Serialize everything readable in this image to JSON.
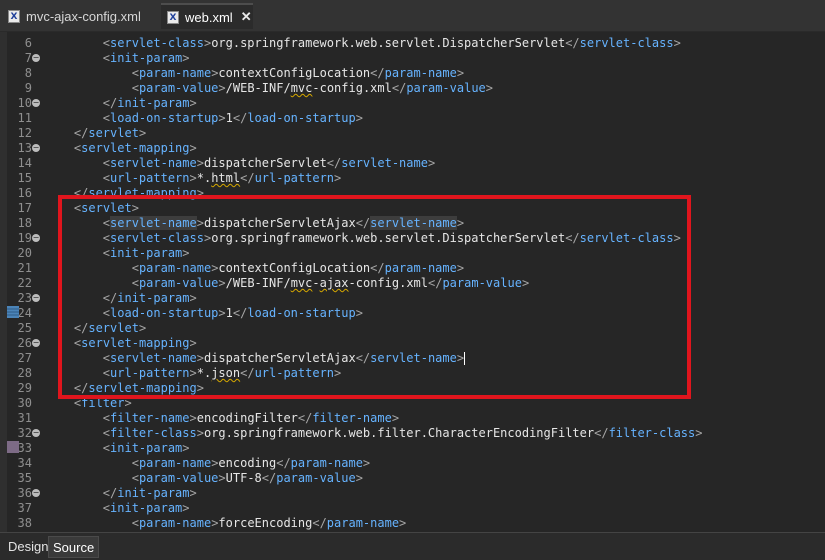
{
  "tabs": [
    {
      "label": "mvc-ajax-config.xml",
      "active": false,
      "icon": "xml-file-icon"
    },
    {
      "label": "web.xml",
      "active": true,
      "icon": "xml-file-icon"
    }
  ],
  "close_glyph": "✕",
  "bottom_tabs": {
    "design": "Design",
    "source": "Source"
  },
  "colors": {
    "tag": "#66b3ff",
    "text": "#e6e6e6",
    "highlight_box": "#e0151d"
  },
  "lines": [
    {
      "n": "6",
      "fold": false,
      "indent": "        ",
      "parts": [
        {
          "c": "p",
          "t": "<"
        },
        {
          "c": "t",
          "t": "servlet-class"
        },
        {
          "c": "p",
          "t": ">"
        },
        {
          "c": "x",
          "t": "org.springframework.web.servlet.DispatcherServlet"
        },
        {
          "c": "p",
          "t": "</"
        },
        {
          "c": "t",
          "t": "servlet-class"
        },
        {
          "c": "p",
          "t": ">"
        }
      ]
    },
    {
      "n": "7",
      "fold": true,
      "indent": "        ",
      "parts": [
        {
          "c": "p",
          "t": "<"
        },
        {
          "c": "t",
          "t": "init-param"
        },
        {
          "c": "p",
          "t": ">"
        }
      ]
    },
    {
      "n": "8",
      "fold": false,
      "indent": "            ",
      "parts": [
        {
          "c": "p",
          "t": "<"
        },
        {
          "c": "t",
          "t": "param-name"
        },
        {
          "c": "p",
          "t": ">"
        },
        {
          "c": "x",
          "t": "contextConfigLocation"
        },
        {
          "c": "p",
          "t": "</"
        },
        {
          "c": "t",
          "t": "param-name"
        },
        {
          "c": "p",
          "t": ">"
        }
      ]
    },
    {
      "n": "9",
      "fold": false,
      "indent": "            ",
      "parts": [
        {
          "c": "p",
          "t": "<"
        },
        {
          "c": "t",
          "t": "param-value"
        },
        {
          "c": "p",
          "t": ">"
        },
        {
          "c": "x",
          "t": "/WEB-INF/"
        },
        {
          "c": "x sq",
          "t": "mvc"
        },
        {
          "c": "x",
          "t": "-config.xml"
        },
        {
          "c": "p",
          "t": "</"
        },
        {
          "c": "t",
          "t": "param-value"
        },
        {
          "c": "p",
          "t": ">"
        }
      ]
    },
    {
      "n": "10",
      "fold": true,
      "indent": "        ",
      "parts": [
        {
          "c": "p",
          "t": "</"
        },
        {
          "c": "t",
          "t": "init-param"
        },
        {
          "c": "p",
          "t": ">"
        }
      ]
    },
    {
      "n": "11",
      "fold": false,
      "indent": "        ",
      "parts": [
        {
          "c": "p",
          "t": "<"
        },
        {
          "c": "t",
          "t": "load-on-startup"
        },
        {
          "c": "p",
          "t": ">"
        },
        {
          "c": "x",
          "t": "1"
        },
        {
          "c": "p",
          "t": "</"
        },
        {
          "c": "t",
          "t": "load-on-startup"
        },
        {
          "c": "p",
          "t": ">"
        }
      ]
    },
    {
      "n": "12",
      "fold": false,
      "indent": "    ",
      "parts": [
        {
          "c": "p",
          "t": "</"
        },
        {
          "c": "t",
          "t": "servlet"
        },
        {
          "c": "p",
          "t": ">"
        }
      ]
    },
    {
      "n": "13",
      "fold": true,
      "indent": "    ",
      "parts": [
        {
          "c": "p",
          "t": "<"
        },
        {
          "c": "t",
          "t": "servlet-mapping"
        },
        {
          "c": "p",
          "t": ">"
        }
      ]
    },
    {
      "n": "14",
      "fold": false,
      "indent": "        ",
      "parts": [
        {
          "c": "p",
          "t": "<"
        },
        {
          "c": "t",
          "t": "servlet-name"
        },
        {
          "c": "p",
          "t": ">"
        },
        {
          "c": "x",
          "t": "dispatcherServlet"
        },
        {
          "c": "p",
          "t": "</"
        },
        {
          "c": "t",
          "t": "servlet-name"
        },
        {
          "c": "p",
          "t": ">"
        }
      ]
    },
    {
      "n": "15",
      "fold": false,
      "indent": "        ",
      "parts": [
        {
          "c": "p",
          "t": "<"
        },
        {
          "c": "t",
          "t": "url-pattern"
        },
        {
          "c": "p",
          "t": ">"
        },
        {
          "c": "x",
          "t": "*."
        },
        {
          "c": "x sq",
          "t": "html"
        },
        {
          "c": "p",
          "t": "</"
        },
        {
          "c": "t",
          "t": "url-pattern"
        },
        {
          "c": "p",
          "t": ">"
        }
      ]
    },
    {
      "n": "16",
      "fold": false,
      "indent": "    ",
      "parts": [
        {
          "c": "p",
          "t": "</"
        },
        {
          "c": "t",
          "t": "servlet-mapping"
        },
        {
          "c": "p",
          "t": ">"
        }
      ]
    },
    {
      "n": "17",
      "fold": false,
      "indent": "    ",
      "parts": [
        {
          "c": "p",
          "t": "<"
        },
        {
          "c": "t",
          "t": "servlet"
        },
        {
          "c": "p",
          "t": ">"
        }
      ]
    },
    {
      "n": "18",
      "fold": false,
      "indent": "        ",
      "parts": [
        {
          "c": "p",
          "t": "<"
        },
        {
          "c": "t hl",
          "t": "servlet-name"
        },
        {
          "c": "p",
          "t": ">"
        },
        {
          "c": "x",
          "t": "dispatcherServletAjax"
        },
        {
          "c": "p",
          "t": "</"
        },
        {
          "c": "t hl",
          "t": "servlet-name"
        },
        {
          "c": "p",
          "t": ">"
        }
      ]
    },
    {
      "n": "19",
      "fold": true,
      "indent": "        ",
      "parts": [
        {
          "c": "p",
          "t": "<"
        },
        {
          "c": "t",
          "t": "servlet-class"
        },
        {
          "c": "p",
          "t": ">"
        },
        {
          "c": "x",
          "t": "org.springframework.web.servlet.DispatcherServlet"
        },
        {
          "c": "p",
          "t": "</"
        },
        {
          "c": "t",
          "t": "servlet-class"
        },
        {
          "c": "p",
          "t": ">"
        }
      ]
    },
    {
      "n": "20",
      "fold": false,
      "indent": "        ",
      "parts": [
        {
          "c": "p",
          "t": "<"
        },
        {
          "c": "t",
          "t": "init-param"
        },
        {
          "c": "p",
          "t": ">"
        }
      ]
    },
    {
      "n": "21",
      "fold": false,
      "indent": "            ",
      "parts": [
        {
          "c": "p",
          "t": "<"
        },
        {
          "c": "t",
          "t": "param-name"
        },
        {
          "c": "p",
          "t": ">"
        },
        {
          "c": "x",
          "t": "contextConfigLocation"
        },
        {
          "c": "p",
          "t": "</"
        },
        {
          "c": "t",
          "t": "param-name"
        },
        {
          "c": "p",
          "t": ">"
        }
      ]
    },
    {
      "n": "22",
      "fold": false,
      "indent": "            ",
      "parts": [
        {
          "c": "p",
          "t": "<"
        },
        {
          "c": "t",
          "t": "param-value"
        },
        {
          "c": "p",
          "t": ">"
        },
        {
          "c": "x",
          "t": "/WEB-INF/"
        },
        {
          "c": "x sq",
          "t": "mvc"
        },
        {
          "c": "x",
          "t": "-"
        },
        {
          "c": "x sq",
          "t": "ajax"
        },
        {
          "c": "x",
          "t": "-config.xml"
        },
        {
          "c": "p",
          "t": "</"
        },
        {
          "c": "t",
          "t": "param-value"
        },
        {
          "c": "p",
          "t": ">"
        }
      ]
    },
    {
      "n": "23",
      "fold": true,
      "indent": "        ",
      "parts": [
        {
          "c": "p",
          "t": "</"
        },
        {
          "c": "t",
          "t": "init-param"
        },
        {
          "c": "p",
          "t": ">"
        }
      ]
    },
    {
      "n": "24",
      "fold": false,
      "indent": "        ",
      "parts": [
        {
          "c": "p",
          "t": "<"
        },
        {
          "c": "t",
          "t": "load-on-startup"
        },
        {
          "c": "p",
          "t": ">"
        },
        {
          "c": "x",
          "t": "1"
        },
        {
          "c": "p",
          "t": "</"
        },
        {
          "c": "t",
          "t": "load-on-startup"
        },
        {
          "c": "p",
          "t": ">"
        }
      ]
    },
    {
      "n": "25",
      "fold": false,
      "indent": "    ",
      "parts": [
        {
          "c": "p",
          "t": "</"
        },
        {
          "c": "t",
          "t": "servlet"
        },
        {
          "c": "p",
          "t": ">"
        }
      ]
    },
    {
      "n": "26",
      "fold": true,
      "indent": "    ",
      "parts": [
        {
          "c": "p",
          "t": "<"
        },
        {
          "c": "t",
          "t": "servlet-mapping"
        },
        {
          "c": "p",
          "t": ">"
        }
      ]
    },
    {
      "n": "27",
      "fold": false,
      "indent": "        ",
      "parts": [
        {
          "c": "p",
          "t": "<"
        },
        {
          "c": "t",
          "t": "servlet-name"
        },
        {
          "c": "p",
          "t": ">"
        },
        {
          "c": "x",
          "t": "dispatcherServletAjax"
        },
        {
          "c": "p",
          "t": "</"
        },
        {
          "c": "t",
          "t": "servlet-name"
        },
        {
          "c": "p",
          "t": ">"
        }
      ]
    },
    {
      "n": "28",
      "fold": false,
      "indent": "        ",
      "parts": [
        {
          "c": "p",
          "t": "<"
        },
        {
          "c": "t",
          "t": "url-pattern"
        },
        {
          "c": "p",
          "t": ">"
        },
        {
          "c": "x",
          "t": "*."
        },
        {
          "c": "x sq",
          "t": "json"
        },
        {
          "c": "p",
          "t": "</"
        },
        {
          "c": "t",
          "t": "url-pattern"
        },
        {
          "c": "p",
          "t": ">"
        }
      ]
    },
    {
      "n": "29",
      "fold": false,
      "indent": "    ",
      "parts": [
        {
          "c": "p",
          "t": "</"
        },
        {
          "c": "t",
          "t": "servlet-mapping"
        },
        {
          "c": "p",
          "t": ">"
        }
      ]
    },
    {
      "n": "30",
      "fold": false,
      "indent": "    ",
      "parts": [
        {
          "c": "p",
          "t": "<"
        },
        {
          "c": "t",
          "t": "filter"
        },
        {
          "c": "p",
          "t": ">"
        }
      ]
    },
    {
      "n": "31",
      "fold": false,
      "indent": "        ",
      "parts": [
        {
          "c": "p",
          "t": "<"
        },
        {
          "c": "t",
          "t": "filter-name"
        },
        {
          "c": "p",
          "t": ">"
        },
        {
          "c": "x",
          "t": "encodingFilter"
        },
        {
          "c": "p",
          "t": "</"
        },
        {
          "c": "t",
          "t": "filter-name"
        },
        {
          "c": "p",
          "t": ">"
        }
      ]
    },
    {
      "n": "32",
      "fold": true,
      "indent": "        ",
      "parts": [
        {
          "c": "p",
          "t": "<"
        },
        {
          "c": "t",
          "t": "filter-class"
        },
        {
          "c": "p",
          "t": ">"
        },
        {
          "c": "x",
          "t": "org.springframework.web.filter.CharacterEncodingFilter"
        },
        {
          "c": "p",
          "t": "</"
        },
        {
          "c": "t",
          "t": "filter-class"
        },
        {
          "c": "p",
          "t": ">"
        }
      ]
    },
    {
      "n": "33",
      "fold": false,
      "indent": "        ",
      "parts": [
        {
          "c": "p",
          "t": "<"
        },
        {
          "c": "t",
          "t": "init-param"
        },
        {
          "c": "p",
          "t": ">"
        }
      ]
    },
    {
      "n": "34",
      "fold": false,
      "indent": "            ",
      "parts": [
        {
          "c": "p",
          "t": "<"
        },
        {
          "c": "t",
          "t": "param-name"
        },
        {
          "c": "p",
          "t": ">"
        },
        {
          "c": "x",
          "t": "encoding"
        },
        {
          "c": "p",
          "t": "</"
        },
        {
          "c": "t",
          "t": "param-name"
        },
        {
          "c": "p",
          "t": ">"
        }
      ]
    },
    {
      "n": "35",
      "fold": false,
      "indent": "            ",
      "parts": [
        {
          "c": "p",
          "t": "<"
        },
        {
          "c": "t",
          "t": "param-value"
        },
        {
          "c": "p",
          "t": ">"
        },
        {
          "c": "x",
          "t": "UTF-8"
        },
        {
          "c": "p",
          "t": "</"
        },
        {
          "c": "t",
          "t": "param-value"
        },
        {
          "c": "p",
          "t": ">"
        }
      ]
    },
    {
      "n": "36",
      "fold": true,
      "indent": "        ",
      "parts": [
        {
          "c": "p",
          "t": "</"
        },
        {
          "c": "t",
          "t": "init-param"
        },
        {
          "c": "p",
          "t": ">"
        }
      ]
    },
    {
      "n": "37",
      "fold": false,
      "indent": "        ",
      "parts": [
        {
          "c": "p",
          "t": "<"
        },
        {
          "c": "t",
          "t": "init-param"
        },
        {
          "c": "p",
          "t": ">"
        }
      ]
    },
    {
      "n": "38",
      "fold": false,
      "indent": "            ",
      "parts": [
        {
          "c": "p",
          "t": "<"
        },
        {
          "c": "t",
          "t": "param-name"
        },
        {
          "c": "p",
          "t": ">"
        },
        {
          "c": "x",
          "t": "forceEncoding"
        },
        {
          "c": "p",
          "t": "</"
        },
        {
          "c": "t",
          "t": "param-name"
        },
        {
          "c": "p",
          "t": ">"
        }
      ]
    }
  ]
}
